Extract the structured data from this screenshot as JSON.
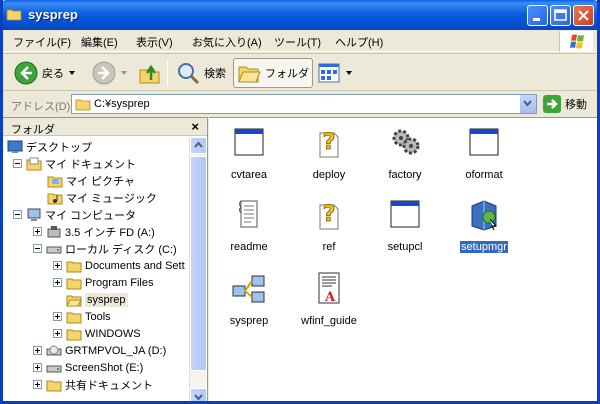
{
  "window": {
    "title": "sysprep"
  },
  "menu": [
    "ファイル(F)",
    "編集(E)",
    "表示(V)",
    "お気に入り(A)",
    "ツール(T)",
    "ヘルプ(H)"
  ],
  "toolbar": {
    "back": "戻る",
    "search": "検索",
    "folders": "フォルダ"
  },
  "address": {
    "label": "アドレス(D)",
    "value": "C:¥sysprep",
    "go": "移動"
  },
  "folder_pane": {
    "title": "フォルダ",
    "tree": [
      {
        "label": "デスクトップ",
        "icon": "desktop-icon"
      },
      {
        "label": "マイ ドキュメント",
        "icon": "my-documents-icon"
      },
      {
        "label": "マイ ピクチャ",
        "icon": "my-pictures-icon"
      },
      {
        "label": "マイ ミュージック",
        "icon": "my-music-icon"
      },
      {
        "label": "マイ コンピュータ",
        "icon": "my-computer-icon"
      },
      {
        "label": "3.5 インチ FD (A:)",
        "icon": "floppy-icon"
      },
      {
        "label": "ローカル ディスク (C:)",
        "icon": "hard-disk-icon"
      },
      {
        "label": "Documents and Sett",
        "icon": "folder-icon"
      },
      {
        "label": "Program Files",
        "icon": "folder-icon"
      },
      {
        "label": "sysprep",
        "icon": "folder-open-icon"
      },
      {
        "label": "Tools",
        "icon": "folder-icon"
      },
      {
        "label": "WINDOWS",
        "icon": "folder-icon"
      },
      {
        "label": "GRTMPVOL_JA (D:)",
        "icon": "cd-drive-icon"
      },
      {
        "label": "ScreenShot (E:)",
        "icon": "hard-disk-icon"
      },
      {
        "label": "共有ドキュメント",
        "icon": "folder-icon"
      }
    ]
  },
  "files": [
    {
      "name": "cvtarea",
      "icon": "application-window-icon"
    },
    {
      "name": "deploy",
      "icon": "help-file-icon"
    },
    {
      "name": "factory",
      "icon": "gears-icon"
    },
    {
      "name": "oformat",
      "icon": "application-window-icon"
    },
    {
      "name": "readme",
      "icon": "text-document-icon"
    },
    {
      "name": "ref",
      "icon": "help-file-icon"
    },
    {
      "name": "setupcl",
      "icon": "application-window-icon"
    },
    {
      "name": "setupmgr",
      "icon": "setup-manager-icon"
    },
    {
      "name": "sysprep",
      "icon": "network-computers-icon"
    },
    {
      "name": "wfinf_guide",
      "icon": "pdf-document-icon"
    }
  ],
  "selected_file": "setupmgr",
  "colors": {
    "titlebar": "#0b5ee1",
    "selection": "#316ac5",
    "pane_border": "#7f9db9"
  }
}
